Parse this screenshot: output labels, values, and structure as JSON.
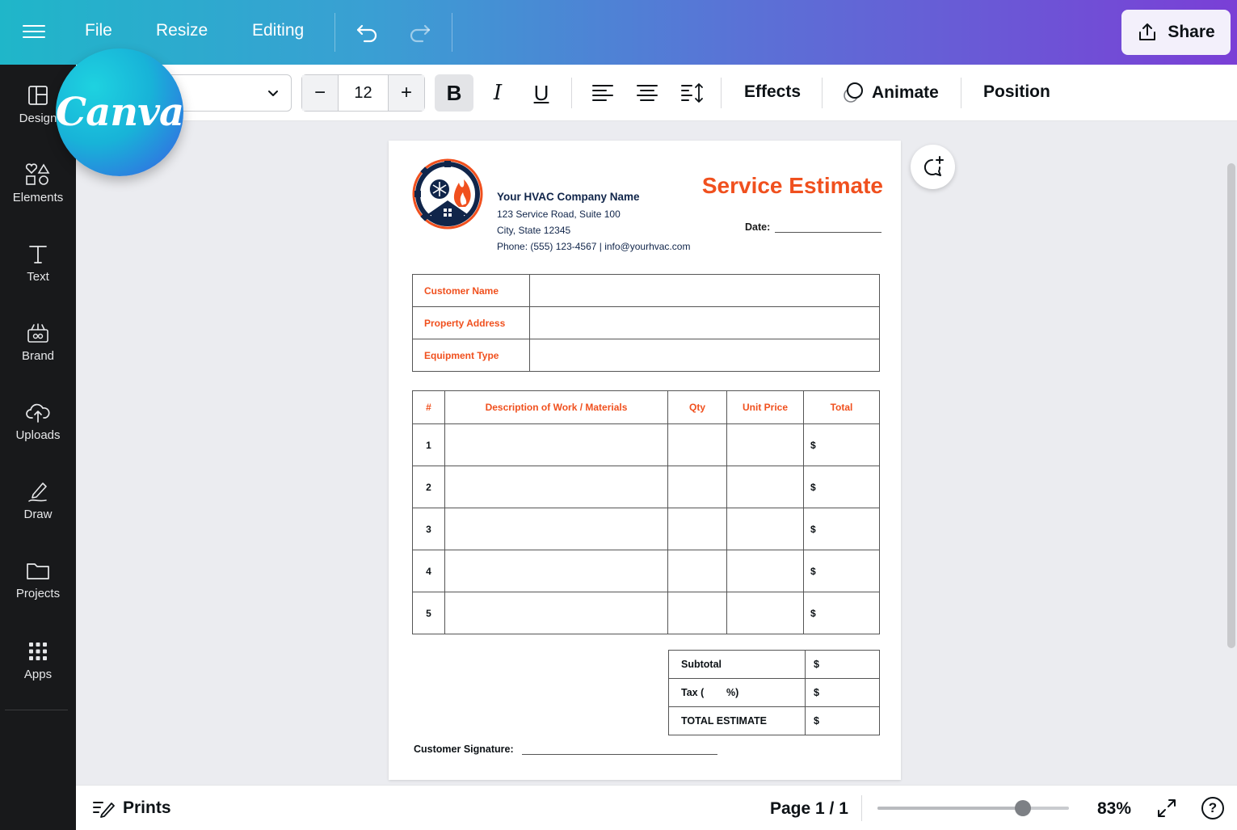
{
  "topbar": {
    "file": "File",
    "resize": "Resize",
    "editing": "Editing",
    "share": "Share"
  },
  "sidebar": {
    "items": [
      {
        "label": "Design",
        "icon": "layout-icon"
      },
      {
        "label": "Elements",
        "icon": "shapes-icon"
      },
      {
        "label": "Text",
        "icon": "text-icon"
      },
      {
        "label": "Brand",
        "icon": "brand-icon"
      },
      {
        "label": "Uploads",
        "icon": "cloud-upload-icon"
      },
      {
        "label": "Draw",
        "icon": "pen-icon"
      },
      {
        "label": "Projects",
        "icon": "folder-icon"
      },
      {
        "label": "Apps",
        "icon": "grid-icon"
      }
    ]
  },
  "brand": {
    "logo_text": "Canva"
  },
  "toolbar": {
    "font_size": "12",
    "minus": "−",
    "plus": "+",
    "bold": "B",
    "italic": "I",
    "underline": "U",
    "effects": "Effects",
    "animate": "Animate",
    "position": "Position"
  },
  "document": {
    "company_name": "Your HVAC Company Name",
    "address1": "123 Service Road, Suite 100",
    "address2": "City, State 12345",
    "contact": "Phone: (555) 123-4567 | info@yourhvac.com",
    "title": "Service Estimate",
    "date_label": "Date:",
    "info_rows": [
      "Customer Name",
      "Property Address",
      "Equipment Type"
    ],
    "items_headers": [
      "#",
      "Description of Work / Materials",
      "Qty",
      "Unit Price",
      "Total"
    ],
    "items_rows": [
      {
        "num": "1",
        "total": "$"
      },
      {
        "num": "2",
        "total": "$"
      },
      {
        "num": "3",
        "total": "$"
      },
      {
        "num": "4",
        "total": "$"
      },
      {
        "num": "5",
        "total": "$"
      }
    ],
    "summary": [
      {
        "label": "Subtotal",
        "value": "$"
      },
      {
        "label": "Tax (        %)",
        "value": "$"
      },
      {
        "label": "TOTAL ESTIMATE",
        "value": "$"
      }
    ],
    "signature_label": "Customer Signature:"
  },
  "bottombar": {
    "notes": "Prints",
    "page": "Page 1 / 1",
    "zoom": "83%",
    "zoom_fraction": 0.76,
    "help": "?"
  },
  "colors": {
    "accent_orange": "#f0501e",
    "navy": "#10254a",
    "sidebar_bg": "#18191b"
  }
}
